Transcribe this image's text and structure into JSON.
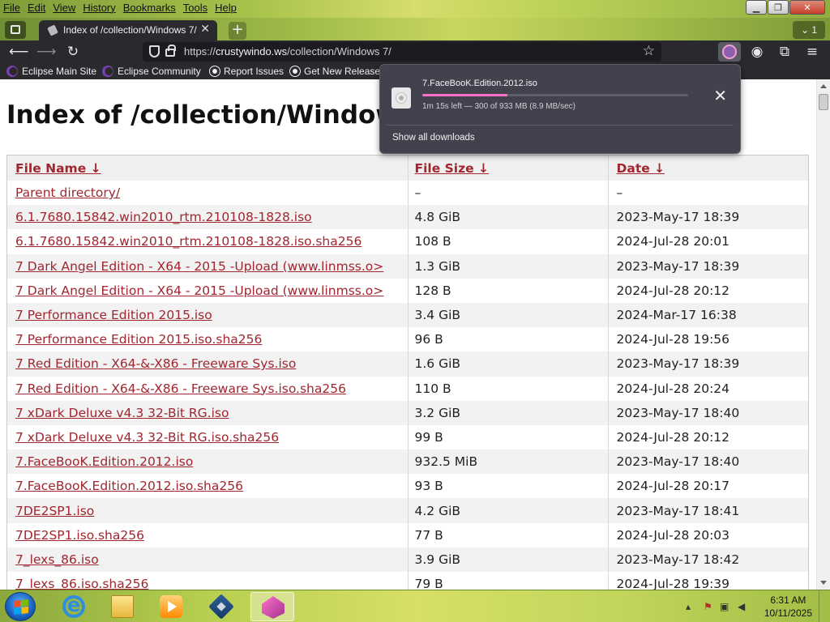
{
  "menubar": {
    "items": [
      {
        "label": "File"
      },
      {
        "label": "Edit"
      },
      {
        "label": "View"
      },
      {
        "label": "History"
      },
      {
        "label": "Bookmarks"
      },
      {
        "label": "Tools"
      },
      {
        "label": "Help"
      }
    ]
  },
  "tabs": {
    "active_title": "Index of /collection/Windows 7/",
    "close_glyph": "✕",
    "new_tab_glyph": "+",
    "tab_count": "1"
  },
  "nav": {
    "url_scheme": "https://",
    "url_host": "crustywindo.ws",
    "url_path": "/collection/Windows 7/"
  },
  "bookmarks": [
    {
      "label": "Eclipse Main Site",
      "icon": "eclipse-icon"
    },
    {
      "label": "Eclipse Community",
      "icon": "eclipse-icon"
    },
    {
      "label": "Report Issues",
      "icon": "github-icon"
    },
    {
      "label": "Get New Releases",
      "icon": "github-icon"
    }
  ],
  "page": {
    "title": "Index of /collection/Windows 7/",
    "headers": {
      "name": "File Name  ↓",
      "size": "File Size  ↓",
      "date": "Date  ↓"
    },
    "rows": [
      {
        "name": "Parent directory/",
        "size": "–",
        "date": "–"
      },
      {
        "name": "6.1.7680.15842.win2010_rtm.210108-1828.iso",
        "size": "4.8 GiB",
        "date": "2023-May-17 18:39"
      },
      {
        "name": "6.1.7680.15842.win2010_rtm.210108-1828.iso.sha256",
        "size": "108 B",
        "date": "2024-Jul-28 20:01"
      },
      {
        "name": "7 Dark Angel Edition - X64 - 2015 -Upload (www.linmss.o>",
        "size": "1.3 GiB",
        "date": "2023-May-17 18:39"
      },
      {
        "name": "7 Dark Angel Edition - X64 - 2015 -Upload (www.linmss.o>",
        "size": "128 B",
        "date": "2024-Jul-28 20:12"
      },
      {
        "name": "7 Performance Edition 2015.iso",
        "size": "3.4 GiB",
        "date": "2024-Mar-17 16:38"
      },
      {
        "name": "7 Performance Edition 2015.iso.sha256",
        "size": "96 B",
        "date": "2024-Jul-28 19:56"
      },
      {
        "name": "7 Red Edition - X64-&-X86 - Freeware Sys.iso",
        "size": "1.6 GiB",
        "date": "2023-May-17 18:39"
      },
      {
        "name": "7 Red Edition - X64-&-X86 - Freeware Sys.iso.sha256",
        "size": "110 B",
        "date": "2024-Jul-28 20:24"
      },
      {
        "name": "7 xDark Deluxe v4.3 32-Bit RG.iso",
        "size": "3.2 GiB",
        "date": "2023-May-17 18:40"
      },
      {
        "name": "7 xDark Deluxe v4.3 32-Bit RG.iso.sha256",
        "size": "99 B",
        "date": "2024-Jul-28 20:12"
      },
      {
        "name": "7.FaceBooK.Edition.2012.iso",
        "size": "932.5 MiB",
        "date": "2023-May-17 18:40"
      },
      {
        "name": "7.FaceBooK.Edition.2012.iso.sha256",
        "size": "93 B",
        "date": "2024-Jul-28 20:17"
      },
      {
        "name": "7DE2SP1.iso",
        "size": "4.2 GiB",
        "date": "2023-May-17 18:41"
      },
      {
        "name": "7DE2SP1.iso.sha256",
        "size": "77 B",
        "date": "2024-Jul-28 20:03"
      },
      {
        "name": "7_lexs_86.iso",
        "size": "3.9 GiB",
        "date": "2023-May-17 18:42"
      },
      {
        "name": "7_lexs_86.iso.sha256",
        "size": "79 B",
        "date": "2024-Jul-28 19:39"
      }
    ]
  },
  "downloads": {
    "filename": "7.FaceBooK.Edition.2012.iso",
    "status": "1m 15s left — 300 of 933 MB (8.9 MB/sec)",
    "progress": 0.32,
    "close_glyph": "✕",
    "show_all": "Show all downloads",
    "accent": "#ff6fc8"
  },
  "taskbar": {
    "apps": [
      {
        "icon": "internet-explorer-icon"
      },
      {
        "icon": "file-explorer-icon"
      },
      {
        "icon": "media-player-icon"
      },
      {
        "icon": "virtualbox-icon"
      },
      {
        "icon": "firefox-icon",
        "active": true
      }
    ],
    "time": "6:31 AM",
    "date": "10/11/2025"
  }
}
